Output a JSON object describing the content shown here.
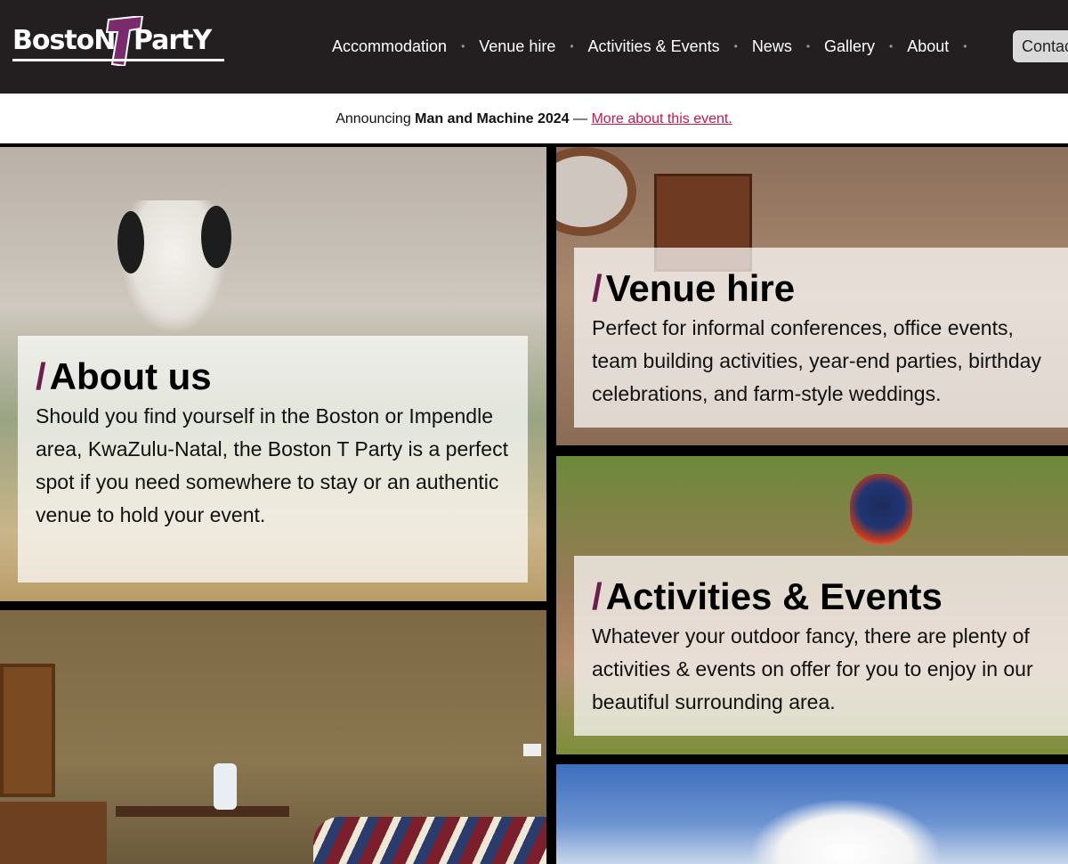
{
  "header": {
    "logo": {
      "left_text": "BostoN",
      "right_text": "PartY",
      "t_letter": "T"
    },
    "nav": [
      {
        "label": "Accommodation"
      },
      {
        "label": "Venue hire"
      },
      {
        "label": "Activities & Events"
      },
      {
        "label": "News"
      },
      {
        "label": "Gallery"
      },
      {
        "label": "About"
      }
    ],
    "separator": "•",
    "contact_label": "Contact"
  },
  "announcement": {
    "prefix": "Announcing",
    "event": "Man and Machine 2024",
    "dash": "—",
    "link": "More about this event."
  },
  "tiles": {
    "about": {
      "slash": "/",
      "title": "About us",
      "text": "Should you find yourself in the Boston or Impendle area, KwaZulu-Natal, the Boston T Party is a perfect spot if you need somewhere to stay or an authentic venue to hold your event."
    },
    "venue": {
      "slash": "/",
      "title": "Venue hire",
      "text": "Perfect for informal conferences, office events, team building activities, year-end parties, birthday celebrations, and farm-style weddings."
    },
    "activities": {
      "slash": "/",
      "title": "Activities & Events",
      "text": "Whatever your outdoor fancy, there are plenty of activities & events on offer for you to enjoy in our beautiful surrounding area."
    }
  },
  "colors": {
    "header_bg": "#231f20",
    "accent": "#c8174b",
    "slash": "#6b1f4d",
    "logo_t": "#7b2a6e"
  }
}
